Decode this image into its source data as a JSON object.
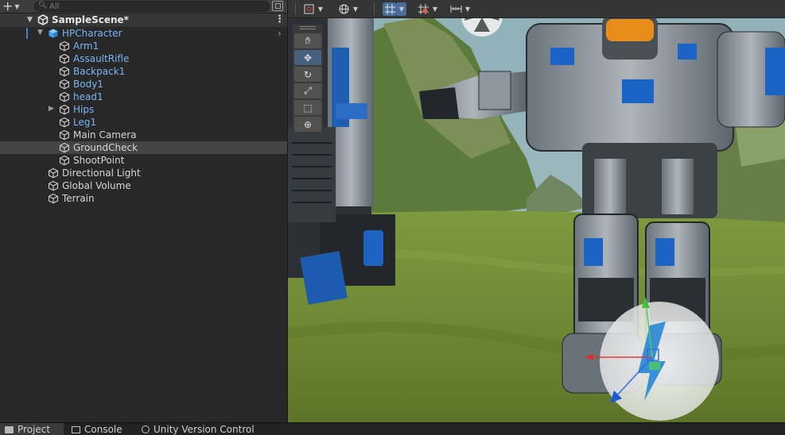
{
  "hierarchy": {
    "add_icon": "plus-icon",
    "search_placeholder": "All",
    "scene_name": "SampleScene*",
    "items": [
      {
        "label": "HPCharacter",
        "depth": 1,
        "expanded": true,
        "prefab": true
      },
      {
        "label": "Arm1",
        "depth": 2,
        "prefab": true
      },
      {
        "label": "AssaultRifle",
        "depth": 2,
        "prefab": true
      },
      {
        "label": "Backpack1",
        "depth": 2,
        "prefab": true
      },
      {
        "label": "Body1",
        "depth": 2,
        "prefab": true
      },
      {
        "label": "head1",
        "depth": 2,
        "prefab": true
      },
      {
        "label": "Hips",
        "depth": 2,
        "collapsed": true,
        "prefab": true
      },
      {
        "label": "Leg1",
        "depth": 2,
        "prefab": true
      },
      {
        "label": "Main Camera",
        "depth": 2
      },
      {
        "label": "GroundCheck",
        "depth": 2,
        "highlighted": true
      },
      {
        "label": "ShootPoint",
        "depth": 2
      },
      {
        "label": "Directional Light",
        "depth": 1
      },
      {
        "label": "Global Volume",
        "depth": 1
      },
      {
        "label": "Terrain",
        "depth": 1
      }
    ]
  },
  "scene_toolbar": {
    "icons": [
      "gizmos-icon",
      "globe-icon",
      "grid-snap-icon",
      "snap-increment-icon",
      "ruler-icon"
    ]
  },
  "scene_tools": [
    "hand-tool-icon",
    "move-tool-icon",
    "rotate-tool-icon",
    "scale-tool-icon",
    "rect-tool-icon",
    "transform-tool-icon"
  ],
  "bottom_tabs": [
    {
      "label": "Project",
      "icon": "folder-icon"
    },
    {
      "label": "Console",
      "icon": "console-icon"
    },
    {
      "label": "Unity Version Control",
      "icon": "version-control-icon"
    }
  ],
  "colors": {
    "prefab_text": "#7cb4f5",
    "active_tool": "#4a6e9a",
    "gizmo_x": "#e23b3b",
    "gizmo_y": "#4fd14f",
    "gizmo_z": "#2f6fe0"
  }
}
